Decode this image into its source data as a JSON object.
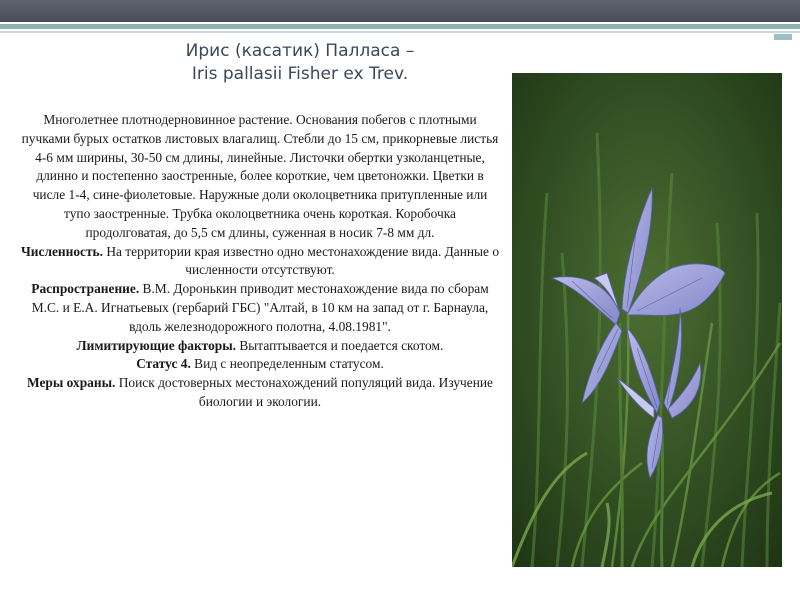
{
  "title": {
    "line1": "Ирис  (касатик) Палласа –",
    "line2": "Iris pallasii Fisher ex Trev."
  },
  "description": "Многолетнее плотнодерновинное растение. Основания побегов с плотными пучками бурых остатков листовых влагалищ. Стебли до 15 см, прикорневые листья 4-6 мм ширины, 30-50 см длины, линейные. Листочки обертки узколанцетные, длинно и постепенно заостренные, более короткие, чем цветоножки. Цветки в числе  1-4, сине-фиолетовые. Наружные доли околоцветника притупленные или тупо заостренные. Трубка околоцветника очень короткая. Коробочка продолговатая, до 5,5 см длины, суженная в носик 7-8 мм дл.",
  "abundance": {
    "label": "Численность.",
    "text": " На территории края известно одно местонахождение вида. Данные о численности отсутствуют."
  },
  "distribution": {
    "label": "Распространение.",
    "text": " В.М. Доронькин приводит местонахождение вида по сборам М.С. и Е.А. Игнатьевых (гербарий ГБС) \"Алтай, в 10 км на запад от г. Барнаула, вдоль железнодорожного полотна, 4.08.1981\"."
  },
  "limiting_factors": {
    "label": "Лимитирующие факторы.",
    "text": " Вытаптывается и поедается скотом."
  },
  "status": {
    "label": "Статус 4.",
    "text": "  Вид с неопределенным статусом."
  },
  "protection": {
    "label": "Меры охраны.",
    "text": " Поиск достоверных местонахождений популяций вида. Изучение биологии и экологии."
  },
  "photo": {
    "icon": "iris-flower-photo",
    "colors": {
      "background": "#2e4a1f",
      "leaf": "#3f6b2a",
      "petal": "#9d9fd6",
      "vein": "#5a5fa8"
    }
  },
  "colors": {
    "title": "#3b4858",
    "top_bar": "#4f5661",
    "accent": "#8fb0b5"
  }
}
